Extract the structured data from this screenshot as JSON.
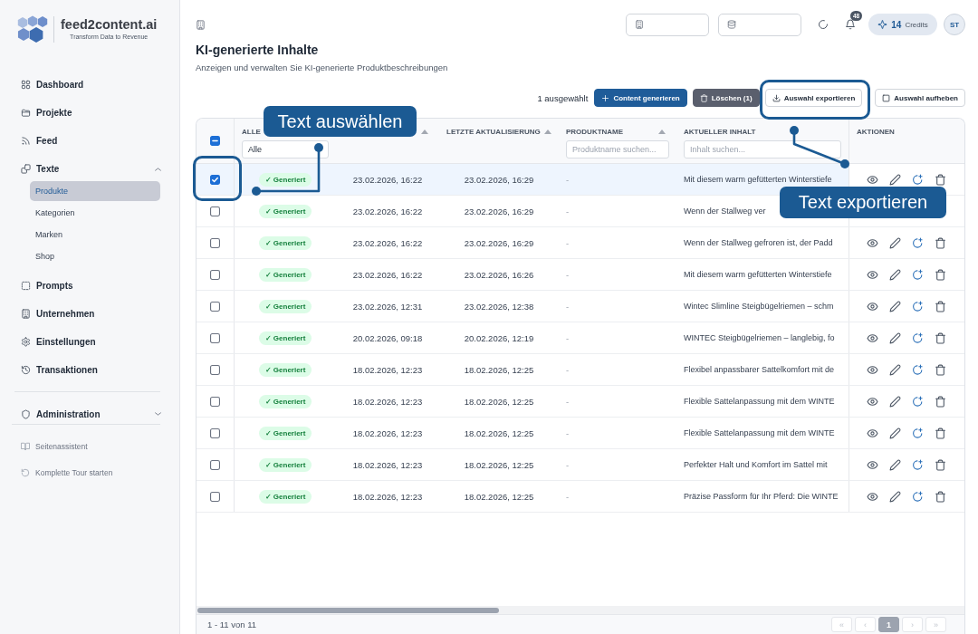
{
  "sidebar": {
    "brand": {
      "name": "feed2content.ai",
      "tagline": "Transform Data to Revenue"
    },
    "items": [
      {
        "label": "Dashboard",
        "selected": false
      },
      {
        "label": "Projekte",
        "selected": false
      },
      {
        "label": "Feed",
        "selected": false
      },
      {
        "label": "Texte",
        "selected": false,
        "expanded": true,
        "children": [
          {
            "label": "Produkte",
            "selected": true
          },
          {
            "label": "Kategorien",
            "selected": false
          },
          {
            "label": "Marken",
            "selected": false
          },
          {
            "label": "Shop",
            "selected": false
          }
        ]
      },
      {
        "label": "Prompts",
        "selected": false
      },
      {
        "label": "Unternehmen",
        "selected": false
      },
      {
        "label": "Einstellungen",
        "selected": false
      },
      {
        "label": "Transaktionen",
        "selected": false
      }
    ],
    "admin": {
      "label": "Administration",
      "expanded": false
    },
    "help_links": [
      {
        "label": "Seitenassistent"
      },
      {
        "label": "Komplette Tour starten"
      }
    ]
  },
  "topbar": {
    "notifications": "48",
    "credits": {
      "amount": "14",
      "label": "Credits"
    },
    "avatar": "ST"
  },
  "page": {
    "title": "KI-generierte Inhalte",
    "subtitle": "Anzeigen und verwalten Sie KI-generierte Produktbeschreibungen"
  },
  "toolbar": {
    "selection": "1 ausgewählt",
    "buttons": [
      {
        "label": "Content generieren",
        "kind": "primary"
      },
      {
        "label": "Löschen (1)",
        "kind": "dark"
      },
      {
        "label": "Auswahl exportieren",
        "kind": "outline"
      },
      {
        "label": "Auswahl aufheben",
        "kind": "outline"
      }
    ]
  },
  "table": {
    "select_all": {
      "indeterminate": true
    },
    "columns": [
      {
        "label": "ALLE",
        "sortable": false,
        "filter": {
          "kind": "select",
          "value": "Alle"
        }
      },
      {
        "sortable": true
      },
      {
        "label": "LETZTE AKTUALISIERUNG",
        "sortable": true
      },
      {
        "label": "PRODUKTNAME",
        "sortable": true,
        "filter": {
          "kind": "text",
          "placeholder": "Produktname suchen..."
        }
      },
      {
        "label": "AKTUELLER INHALT",
        "sortable": false,
        "filter": {
          "kind": "text",
          "placeholder": "Inhalt suchen..."
        }
      },
      {
        "label": "AKTIONEN",
        "sortable": false
      }
    ],
    "rows": [
      {
        "checked": true,
        "status": {
          "label": "✓ Generiert",
          "kind": "generated"
        },
        "created": "23.02.2026, 16:22",
        "updated": "23.02.2026, 16:29",
        "product": "-",
        "content": "Mit diesem warm gefütterten Winterstiefe",
        "actions_visible": true
      },
      {
        "checked": false,
        "status": {
          "label": "✓ Generiert",
          "kind": "generated"
        },
        "created": "23.02.2026, 16:22",
        "updated": "23.02.2026, 16:29",
        "product": "-",
        "content": "Wenn der Stallweg ver",
        "actions_visible": false
      },
      {
        "checked": false,
        "status": {
          "label": "✓ Generiert",
          "kind": "generated"
        },
        "created": "23.02.2026, 16:22",
        "updated": "23.02.2026, 16:29",
        "product": "-",
        "content": "Wenn der Stallweg gefroren ist, der Padd",
        "actions_visible": true
      },
      {
        "checked": false,
        "status": {
          "label": "✓ Generiert",
          "kind": "generated"
        },
        "created": "23.02.2026, 16:22",
        "updated": "23.02.2026, 16:26",
        "product": "-",
        "content": "Mit diesem warm gefütterten Winterstiefe",
        "actions_visible": true
      },
      {
        "checked": false,
        "status": {
          "label": "✓ Generiert",
          "kind": "generated"
        },
        "created": "23.02.2026, 12:31",
        "updated": "23.02.2026, 12:38",
        "product": "-",
        "content": "Wintec Slimline Steigbügelriemen – schm",
        "actions_visible": true
      },
      {
        "checked": false,
        "status": {
          "label": "✓ Generiert",
          "kind": "generated"
        },
        "created": "20.02.2026, 09:18",
        "updated": "20.02.2026, 12:19",
        "product": "-",
        "content": "WINTEC Steigbügelriemen – langlebig, fo",
        "actions_visible": true
      },
      {
        "checked": false,
        "status": {
          "label": "✓ Generiert",
          "kind": "generated"
        },
        "created": "18.02.2026, 12:23",
        "updated": "18.02.2026, 12:25",
        "product": "-",
        "content": "Flexibel anpassbarer Sattelkomfort mit de",
        "actions_visible": true
      },
      {
        "checked": false,
        "status": {
          "label": "✓ Generiert",
          "kind": "generated"
        },
        "created": "18.02.2026, 12:23",
        "updated": "18.02.2026, 12:25",
        "product": "-",
        "content": "Flexible Sattelanpassung mit dem WINTE",
        "actions_visible": true
      },
      {
        "checked": false,
        "status": {
          "label": "✓ Generiert",
          "kind": "generated"
        },
        "created": "18.02.2026, 12:23",
        "updated": "18.02.2026, 12:25",
        "product": "-",
        "content": "Flexible Sattelanpassung mit dem WINTE",
        "actions_visible": true
      },
      {
        "checked": false,
        "status": {
          "label": "✓ Generiert",
          "kind": "generated"
        },
        "created": "18.02.2026, 12:23",
        "updated": "18.02.2026, 12:25",
        "product": "-",
        "content": "Perfekter Halt und Komfort im Sattel mit",
        "actions_visible": true
      },
      {
        "checked": false,
        "status": {
          "label": "✓ Generiert",
          "kind": "generated"
        },
        "created": "18.02.2026, 12:23",
        "updated": "18.02.2026, 12:25",
        "product": "-",
        "content": "Präzise Passform für Ihr Pferd: Die WINTE",
        "actions_visible": true
      }
    ],
    "footer": {
      "range": "1 - 11 von 11",
      "pages": [
        {
          "label": "«",
          "selected": false,
          "disabled": true
        },
        {
          "label": "‹",
          "selected": false,
          "disabled": true
        },
        {
          "label": "1",
          "selected": true,
          "disabled": false
        },
        {
          "label": "›",
          "selected": false,
          "disabled": true
        },
        {
          "label": "»",
          "selected": false,
          "disabled": true
        }
      ]
    }
  },
  "annotations": [
    {
      "label": "Text auswählen"
    },
    {
      "label": "Text exportieren"
    }
  ]
}
